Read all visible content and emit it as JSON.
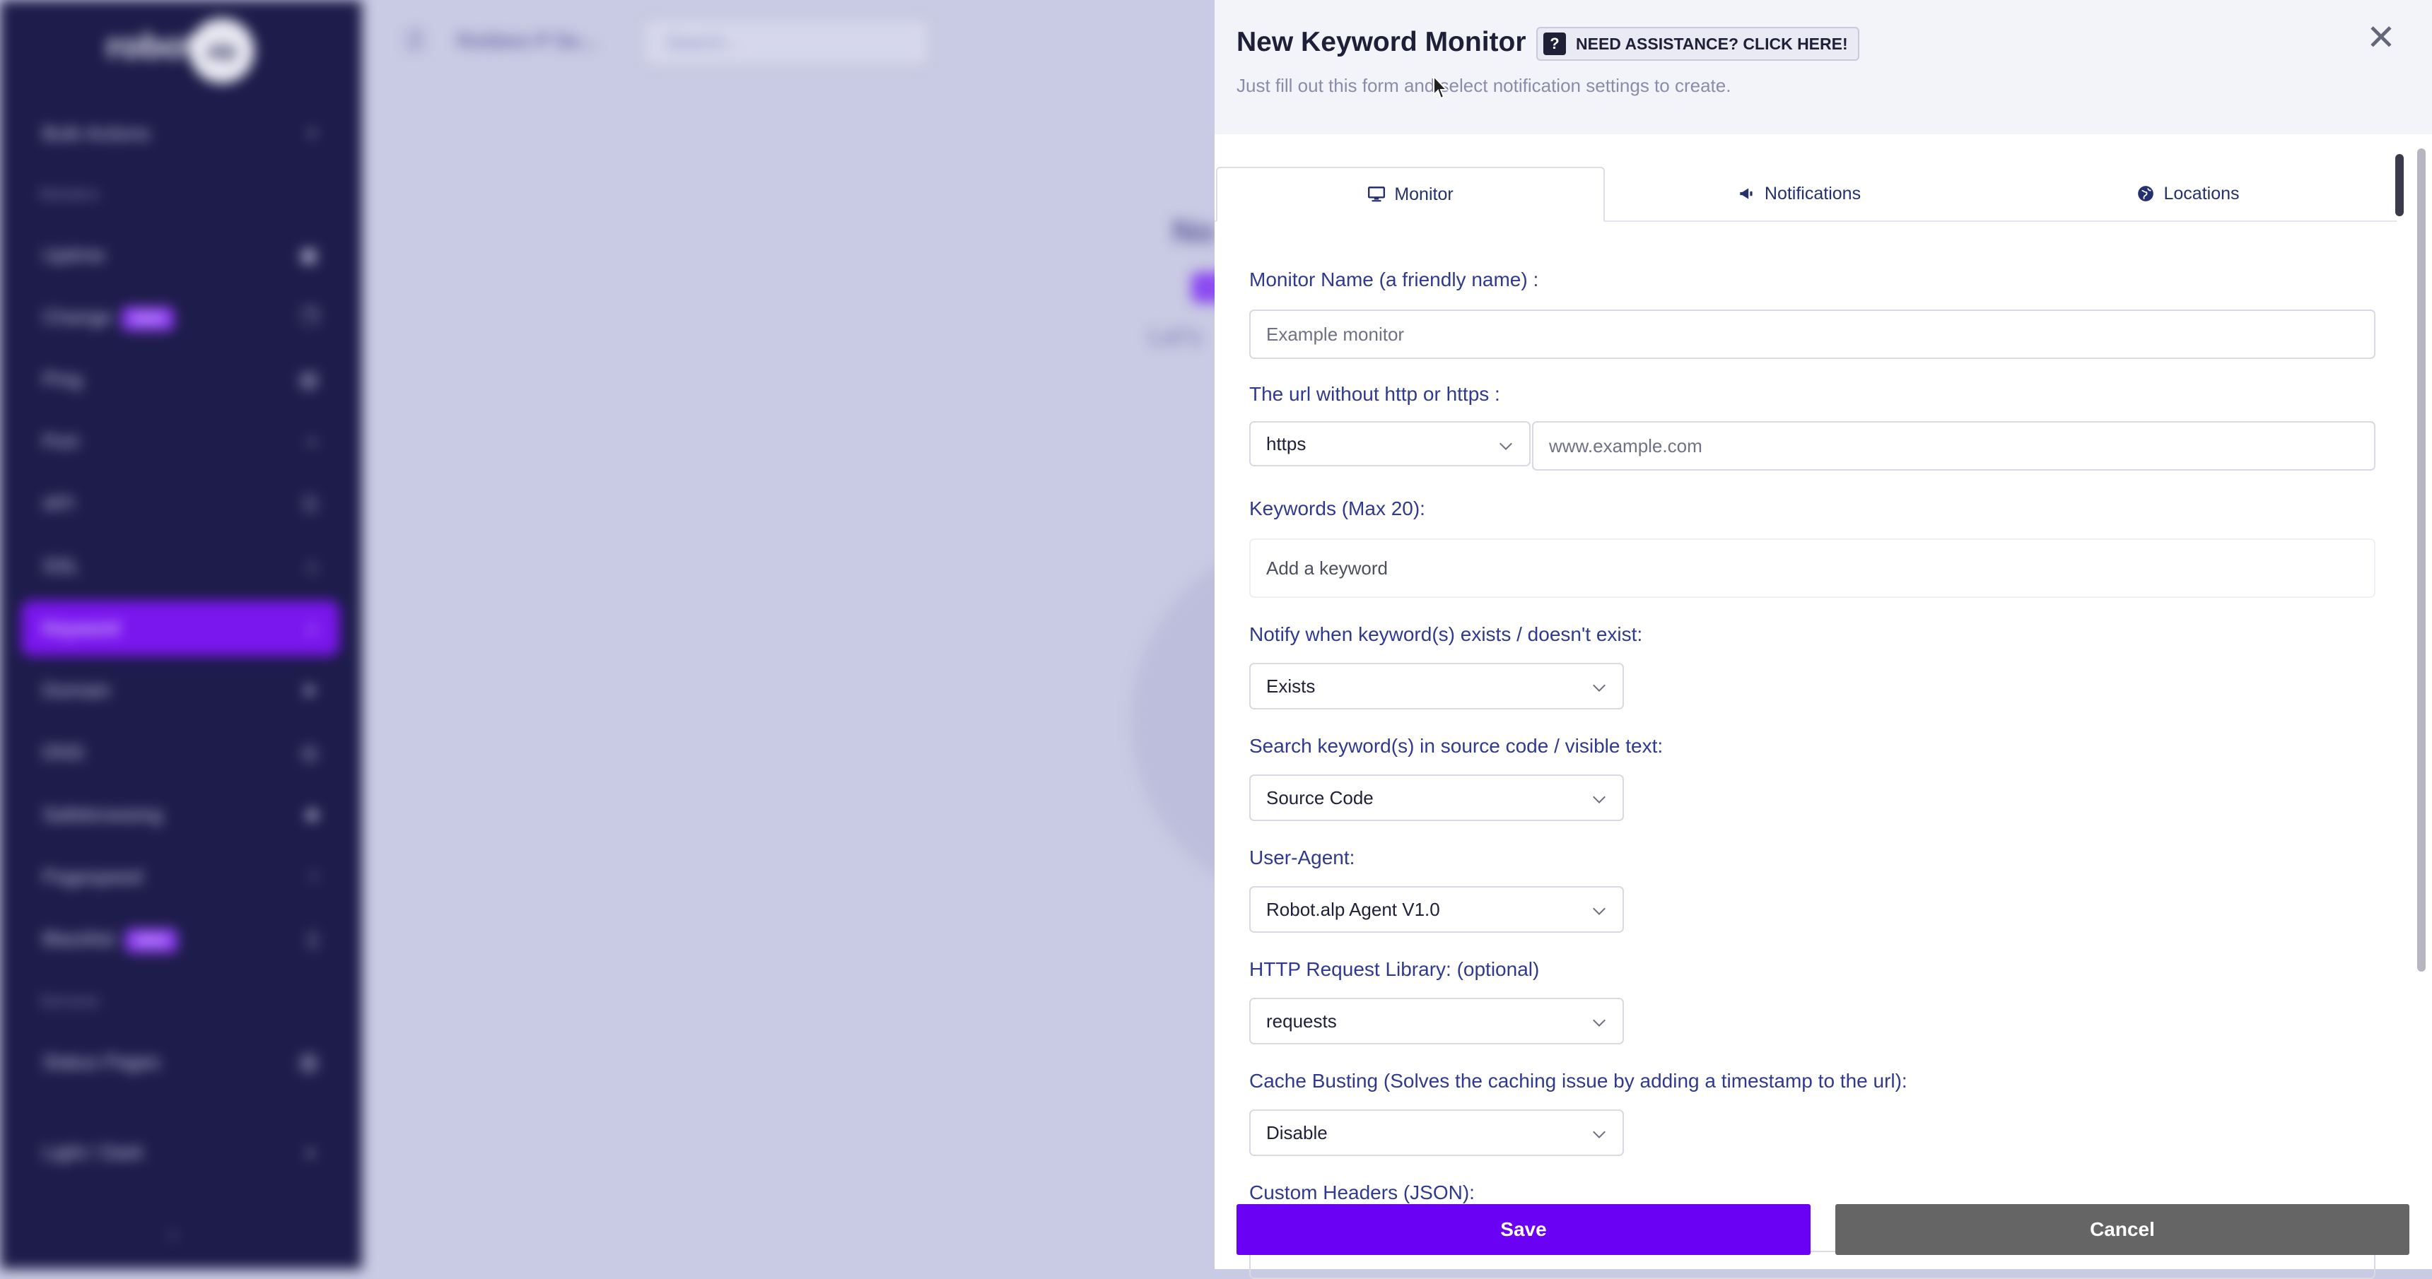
{
  "background": {
    "logo_text": "robot",
    "logo_badge": "alp",
    "workspace": "Robben P Se...",
    "search_placeholder": "Search...",
    "main_title": "No",
    "main_subtitle": "Let's",
    "sidebar": {
      "items": [
        {
          "label": "Bulk Actions",
          "icon": "plus-icon"
        },
        {
          "label": "Uptime",
          "icon": "monitor-icon"
        },
        {
          "label": "Change",
          "badge": "NEW",
          "icon": "copy-icon"
        },
        {
          "label": "Ping",
          "icon": "server-icon"
        },
        {
          "label": "Port",
          "icon": "plug-icon"
        },
        {
          "label": "API",
          "icon": "code-icon"
        },
        {
          "label": "SSL",
          "icon": "lock-icon"
        },
        {
          "label": "Keyword",
          "icon": "search-icon",
          "active": true
        },
        {
          "label": "Domain",
          "icon": "send-icon"
        },
        {
          "label": "DNS",
          "icon": "globe-icon"
        },
        {
          "label": "Safebrowsing",
          "icon": "shield-icon"
        },
        {
          "label": "Pagespeed",
          "icon": "gauge-icon"
        },
        {
          "label": "Blacklist",
          "badge": "NEW",
          "icon": "file-icon"
        },
        {
          "label": "Status Pages",
          "icon": "bars-icon"
        },
        {
          "label": "Light / Dark",
          "icon": "theme-icon"
        }
      ],
      "sections": [
        "Monitors",
        "Services"
      ]
    }
  },
  "panel": {
    "title": "New Keyword Monitor",
    "assist_label": "NEED ASSISTANCE? CLICK HERE!",
    "assist_icon": "?",
    "subtitle": "Just fill out this form and select notification settings to create.",
    "close_symbol": "✕",
    "tabs": [
      {
        "label": "Monitor",
        "icon": "desktop-icon",
        "active": true
      },
      {
        "label": "Notifications",
        "icon": "megaphone-icon"
      },
      {
        "label": "Locations",
        "icon": "globe-icon"
      }
    ],
    "form": {
      "name_label": "Monitor Name (a friendly name) :",
      "name_placeholder": "Example monitor",
      "url_label": "The url without http or https :",
      "protocol_value": "https",
      "url_placeholder": "www.example.com",
      "keywords_label": "Keywords (Max 20):",
      "keywords_placeholder": "Add a keyword",
      "notify_label": "Notify when keyword(s) exists / doesn't exist:",
      "notify_value": "Exists",
      "search_in_label": "Search keyword(s) in source code / visible text:",
      "search_in_value": "Source Code",
      "user_agent_label": "User-Agent:",
      "user_agent_value": "Robot.alp Agent V1.0",
      "library_label": "HTTP Request Library: (optional)",
      "library_value": "requests",
      "cache_label": "Cache Busting (Solves the caching issue by adding a timestamp to the url):",
      "cache_value": "Disable",
      "headers_label": "Custom Headers (JSON):"
    },
    "save_label": "Save",
    "cancel_label": "Cancel"
  },
  "colors": {
    "accent": "#6a00f4",
    "sidebar_bg": "#1d1c4a",
    "label": "#2f3a8f",
    "cancel": "#656565"
  }
}
